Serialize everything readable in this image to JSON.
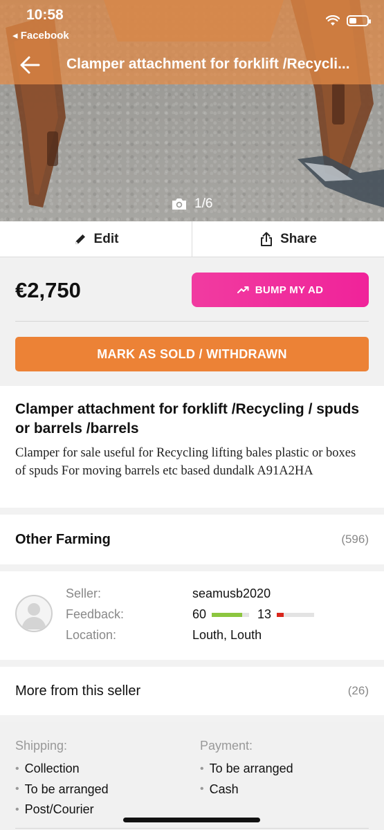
{
  "status_bar": {
    "time": "10:58",
    "back_app": "◂ Facebook"
  },
  "header": {
    "title": "Clamper attachment for forklift   /Recycli...",
    "photo_counter": "1/6"
  },
  "actions": {
    "edit_label": "Edit",
    "share_label": "Share"
  },
  "pricing": {
    "price": "€2,750",
    "bump_label": "BUMP MY AD",
    "mark_sold_label": "MARK AS SOLD / WITHDRAWN"
  },
  "listing": {
    "title": "Clamper attachment for forklift   /Recycling / spuds or barrels /barrels",
    "description": "Clamper for sale useful for Recycling lifting bales plastic or boxes of spuds  For moving barrels  etc based dundalk A91A2HA"
  },
  "category": {
    "name": "Other Farming",
    "count": "(596)"
  },
  "seller": {
    "labels": {
      "seller": "Seller:",
      "feedback": "Feedback:",
      "location": "Location:"
    },
    "name": "seamusb2020",
    "positive_feedback": "60",
    "negative_feedback": "13",
    "positive_ratio": 0.82,
    "negative_ratio": 0.18,
    "location": "Louth, Louth"
  },
  "more_from_seller": {
    "label": "More from this seller",
    "count": "(26)"
  },
  "shipping": {
    "heading": "Shipping:",
    "items": [
      "Collection",
      "To be arranged",
      "Post/Courier"
    ]
  },
  "payment": {
    "heading": "Payment:",
    "items": [
      "To be arranged",
      "Cash"
    ]
  },
  "colors": {
    "accent_orange": "#ec8236",
    "bump_pink": "#f0239a",
    "feedback_positive": "#8cc63f",
    "feedback_negative": "#d9261c"
  },
  "icons": [
    "back-arrow-icon",
    "camera-icon",
    "pencil-icon",
    "share-icon",
    "trend-up-icon",
    "avatar-placeholder-icon",
    "wifi-icon",
    "battery-icon"
  ]
}
